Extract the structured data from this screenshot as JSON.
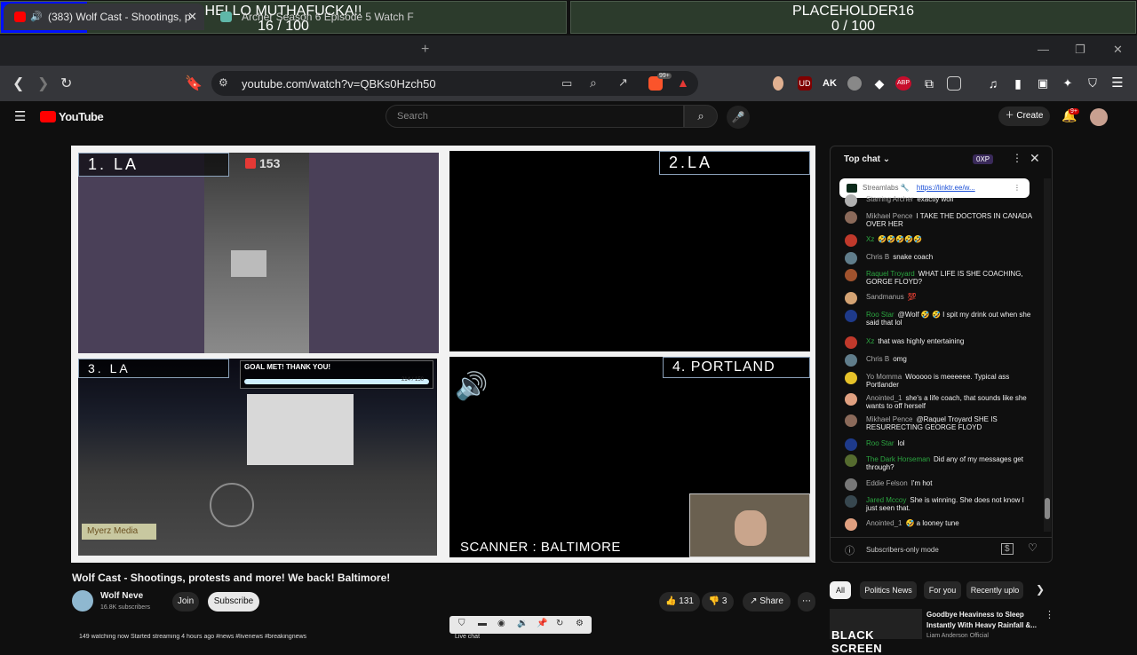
{
  "goals": [
    {
      "title": "HELLO MUTHAFUCKA!!",
      "progress_text": "16 / 100",
      "progress": 0.16
    },
    {
      "title": "PLACEHOLDER16",
      "progress_text": "0 / 100",
      "progress": 0.0
    }
  ],
  "tabs": [
    {
      "title": "(383) Wolf Cast - Shootings, p",
      "active": true
    },
    {
      "title": "Archer Season 6 Episode 5 Watch Fre",
      "active": false
    }
  ],
  "address": {
    "url": "youtube.com/watch?v=QBKs0Hzch50"
  },
  "extensions": {
    "ud": "UD",
    "abp": "ABP",
    "ak": "AK",
    "wave_count": "99+"
  },
  "youtube": {
    "logo": "YouTube",
    "search_placeholder": "Search",
    "create_label": "Create",
    "notification_count": "9+"
  },
  "video": {
    "quads": [
      {
        "label": "1. LA",
        "viewer_count": "153"
      },
      {
        "label": "2.LA"
      },
      {
        "label": "3. LA",
        "goal_text": "GOAL MET! THANK YOU!",
        "goal_count": "214 / 150",
        "watermark": "Myerz Media"
      },
      {
        "label": "4. PORTLAND",
        "footer": "SCANNER : BALTIMORE"
      }
    ]
  },
  "below_video": {
    "title": "Wolf Cast - Shootings, protests and more! We back! Baltimore!",
    "channel": "Wolf Neve",
    "subscribers": "16.8K subscribers",
    "join": "Join",
    "subscribe": "Subscribe",
    "likes": "131",
    "dislikes": "3",
    "share": "Share",
    "watching": "149 watching now  Started streaming 4 hours ago  #news #livenews #breakingnews",
    "live_chat": "Live chat"
  },
  "chat": {
    "header": "Top chat",
    "xp": "0XP",
    "pinned_author": "Streamlabs",
    "pinned_link": "https://linktr.ee/w...",
    "messages": [
      {
        "author": "Starring Archer",
        "text": "exactly wolf",
        "color": "#b0b0b0"
      },
      {
        "author": "Mikhael Pence",
        "text": "I TAKE THE DOCTORS IN CANADA OVER HER",
        "color": "#8b6a5a"
      },
      {
        "author": "Xz",
        "text": "🤣🤣🤣🤣🤣",
        "color": "#c0392b"
      },
      {
        "author": "Chris B",
        "text": "snake coach",
        "color": "#607d8b"
      },
      {
        "author": "Raquel Troyard",
        "text": "WHAT LIFE IS SHE COACHING, GORGE FLOYD?",
        "color": "#a0522d"
      },
      {
        "author": "Sandmanus",
        "text": "💯",
        "color": "#d4a373"
      },
      {
        "author": "Roo Star",
        "text": "@Wolf 🤣 🤣 I spit my drink out when she said that lol",
        "color": "#1e3a8a"
      },
      {
        "author": "Xz",
        "text": "that was highly entertaining",
        "color": "#c0392b"
      },
      {
        "author": "Chris B",
        "text": "omg",
        "color": "#607d8b"
      },
      {
        "author": "Yo Momma",
        "text": "Wooooo is meeeeee. Typical ass Portlander",
        "color": "#e6c229"
      },
      {
        "author": "Anointed_1",
        "text": "she's a life coach, that sounds like she wants to off herself",
        "color": "#e0a080"
      },
      {
        "author": "Mikhael Pence",
        "text": "@Raquel Troyard SHE IS RESURRECTING GEORGE FLOYD",
        "color": "#8b6a5a"
      },
      {
        "author": "Roo Star",
        "text": "lol",
        "color": "#1e3a8a"
      },
      {
        "author": "The Dark Horseman",
        "text": "Did any of my messages get through?",
        "color": "#556b2f"
      },
      {
        "author": "Eddie Felson",
        "text": "I'm hot",
        "color": "#777"
      },
      {
        "author": "Jared Mccoy",
        "text": "She is winning. She does not know I just seen that.",
        "color": "#37474f"
      },
      {
        "author": "Anointed_1",
        "text": "🤣 a looney tune",
        "color": "#e0a080"
      }
    ],
    "footer": "Subscribers-only mode"
  },
  "chips": [
    "All",
    "Politics News",
    "For you",
    "Recently uplo"
  ],
  "recommended": {
    "title": "Goodbye Heaviness to Sleep Instantly With Heavy Rainfall &...",
    "channel": "Liam Anderson Official",
    "thumb_text": "BLACK SCREEN"
  },
  "colors": {
    "accent": "#3ea6ff",
    "youtube_red": "#ff0000",
    "goal_fill": "#0010ff"
  }
}
